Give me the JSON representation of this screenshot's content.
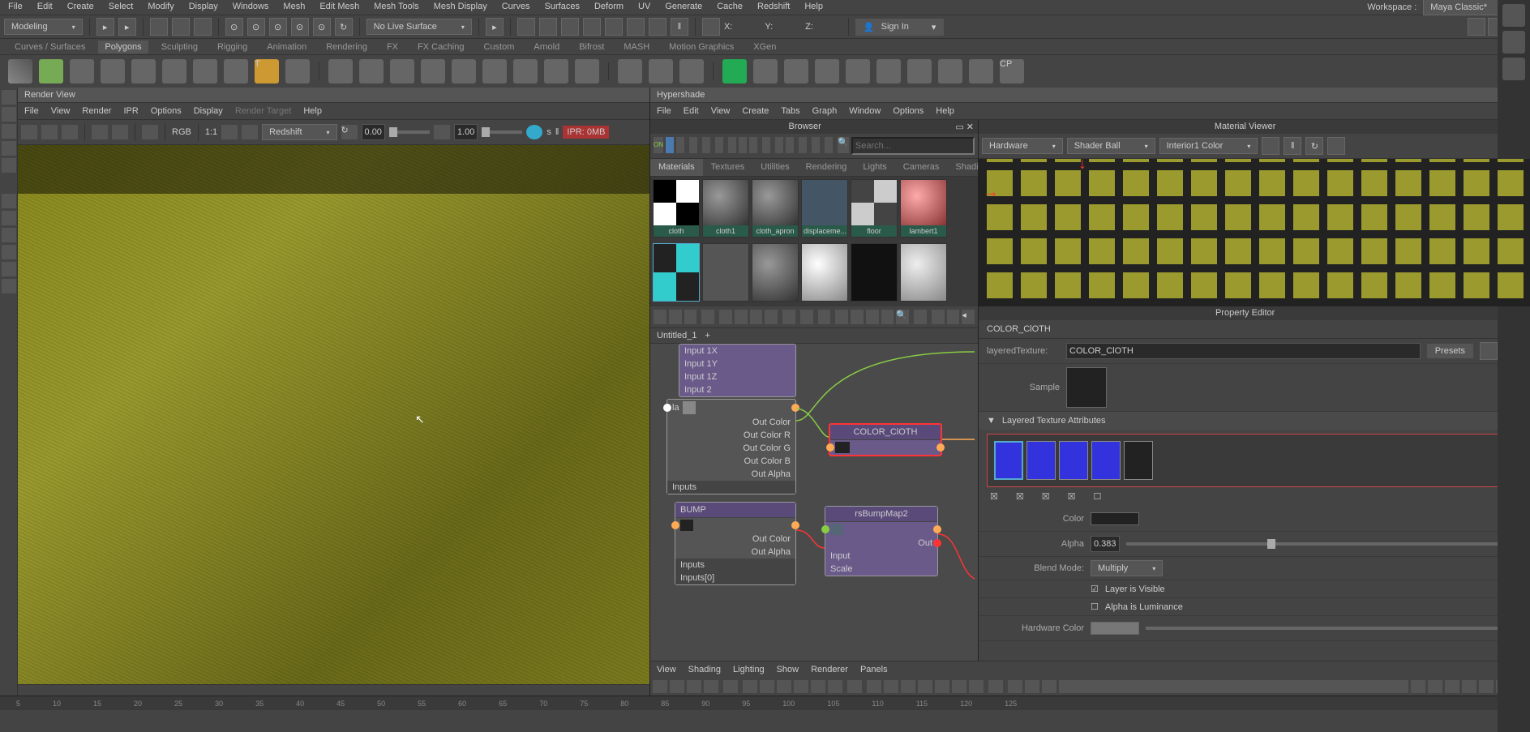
{
  "menu": {
    "items": [
      "File",
      "Edit",
      "Create",
      "Select",
      "Modify",
      "Display",
      "Windows",
      "Mesh",
      "Edit Mesh",
      "Mesh Tools",
      "Mesh Display",
      "Curves",
      "Surfaces",
      "Deform",
      "UV",
      "Generate",
      "Cache",
      "Redshift",
      "Help"
    ],
    "workspace_label": "Workspace :",
    "workspace_value": "Maya Classic*"
  },
  "toolbar": {
    "mode": "Modeling",
    "surface": "No Live Surface",
    "axis_x": "X:",
    "axis_y": "Y:",
    "axis_z": "Z:",
    "signin": "Sign In"
  },
  "shelf_tabs": [
    "Curves / Surfaces",
    "Polygons",
    "Sculpting",
    "Rigging",
    "Animation",
    "Rendering",
    "FX",
    "FX Caching",
    "Custom",
    "Arnold",
    "Bifrost",
    "MASH",
    "Motion Graphics",
    "XGen"
  ],
  "renderview": {
    "title": "Render View",
    "menu": [
      "File",
      "View",
      "Render",
      "IPR",
      "Options",
      "Display",
      "Render Target",
      "Help"
    ],
    "rgb": "RGB",
    "ratio": "1:1",
    "renderer": "Redshift",
    "v1": "0.00",
    "v2": "1.00",
    "s": "s",
    "ipr": "IPR: 0MB"
  },
  "hypershade": {
    "title": "Hypershade",
    "menu": [
      "File",
      "Edit",
      "View",
      "Create",
      "Tabs",
      "Graph",
      "Window",
      "Options",
      "Help"
    ],
    "browser": {
      "title": "Browser",
      "search": "Search...",
      "on": "ON",
      "tabs": [
        "Materials",
        "Textures",
        "Utilities",
        "Rendering",
        "Lights",
        "Cameras",
        "Shadi"
      ],
      "materials": [
        "cloth",
        "cloth1",
        "cloth_apron",
        "displaceme...",
        "floor",
        "lambert1"
      ]
    },
    "matviewer": {
      "title": "Material Viewer",
      "hw": "Hardware",
      "shader": "Shader Ball",
      "interior": "Interior1 Color"
    },
    "graph": {
      "tab": "Untitled_1",
      "plus": "+",
      "node1_rows": [
        "Input 1X",
        "Input 1Y",
        "Input 1Z",
        "Input 2"
      ],
      "node1_out": [
        "Out Color",
        "Out Color R",
        "Out Color G",
        "Out Color B",
        "Out Alpha"
      ],
      "inputs": "Inputs",
      "la": "la",
      "color_cloth": "COLOR_ClOTH",
      "bump": "BUMP",
      "bump_out": [
        "Out Color",
        "Out Alpha"
      ],
      "inputs0": "Inputs[0]",
      "rsbump": "rsBumpMap2",
      "rsbump_rows": [
        "Input",
        "Scale"
      ],
      "out": "Out"
    },
    "propeditor": {
      "title": "Property Editor",
      "name": "COLOR_ClOTH",
      "layered_label": "layeredTexture:",
      "layered_value": "COLOR_ClOTH",
      "presets": "Presets",
      "sample": "Sample",
      "section": "Layered Texture Attributes",
      "color_label": "Color",
      "alpha_label": "Alpha",
      "alpha_value": "0.383",
      "blend_label": "Blend Mode:",
      "blend_value": "Multiply",
      "layer_visible": "Layer is Visible",
      "alpha_lum": "Alpha is Luminance",
      "hw_color": "Hardware Color"
    }
  },
  "viewport_menu": [
    "View",
    "Shading",
    "Lighting",
    "Show",
    "Renderer",
    "Panels"
  ],
  "timeline": [
    "5",
    "10",
    "15",
    "20",
    "25",
    "30",
    "35",
    "40",
    "45",
    "50",
    "55",
    "60",
    "65",
    "70",
    "75",
    "80",
    "85",
    "90",
    "95",
    "100",
    "105",
    "110",
    "115",
    "120",
    "125"
  ]
}
